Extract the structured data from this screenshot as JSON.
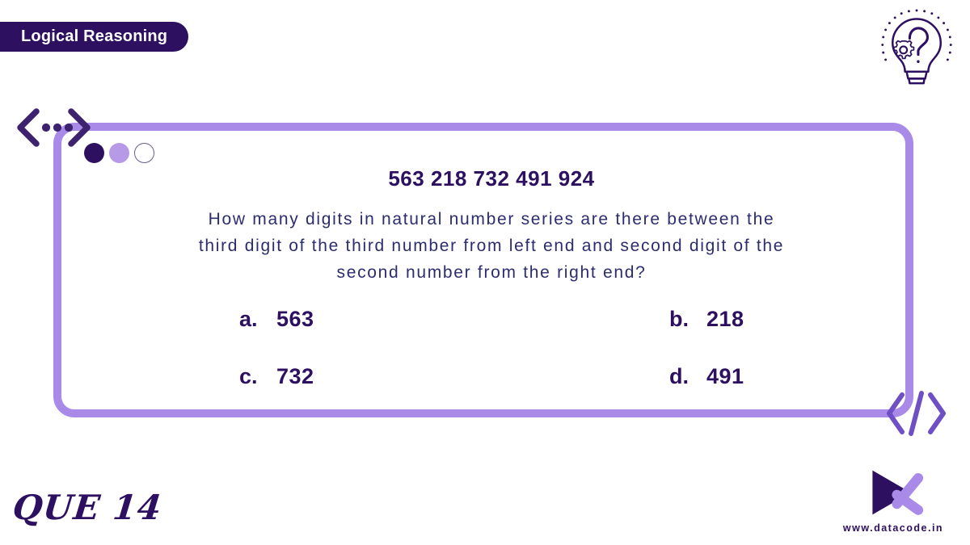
{
  "header": {
    "category_label": "Logical Reasoning",
    "bulb_icon": "lightbulb-question-gear-icon"
  },
  "card": {
    "window_dots": [
      {
        "name": "window-dot-dark",
        "color": "#2d1060"
      },
      {
        "name": "window-dot-light",
        "color": "#b69ae8"
      },
      {
        "name": "window-dot-empty",
        "color": "#ffffff"
      }
    ],
    "series": "563 218 732 491 924",
    "question_lines": [
      "How many digits in natural number series are there between the",
      "third digit of the third number from left end and second digit of the",
      "second number from the right end?"
    ],
    "options": [
      {
        "letter": "a.",
        "value": "563"
      },
      {
        "letter": "b.",
        "value": "218"
      },
      {
        "letter": "c.",
        "value": "732"
      },
      {
        "letter": "d.",
        "value": "491"
      }
    ],
    "code_bracket_icon": "code-brackets-icon",
    "chevrons_icon": "chevron-dots-decoration-icon"
  },
  "footer": {
    "question_number": "QUE 14",
    "website": "www.datacode.in",
    "logo_icon": "datacode-play-k-logo"
  },
  "colors": {
    "brand_dark": "#2d1060",
    "brand_light": "#a98ae8",
    "text_navy": "#2b2d6e",
    "background": "#ffffff"
  }
}
